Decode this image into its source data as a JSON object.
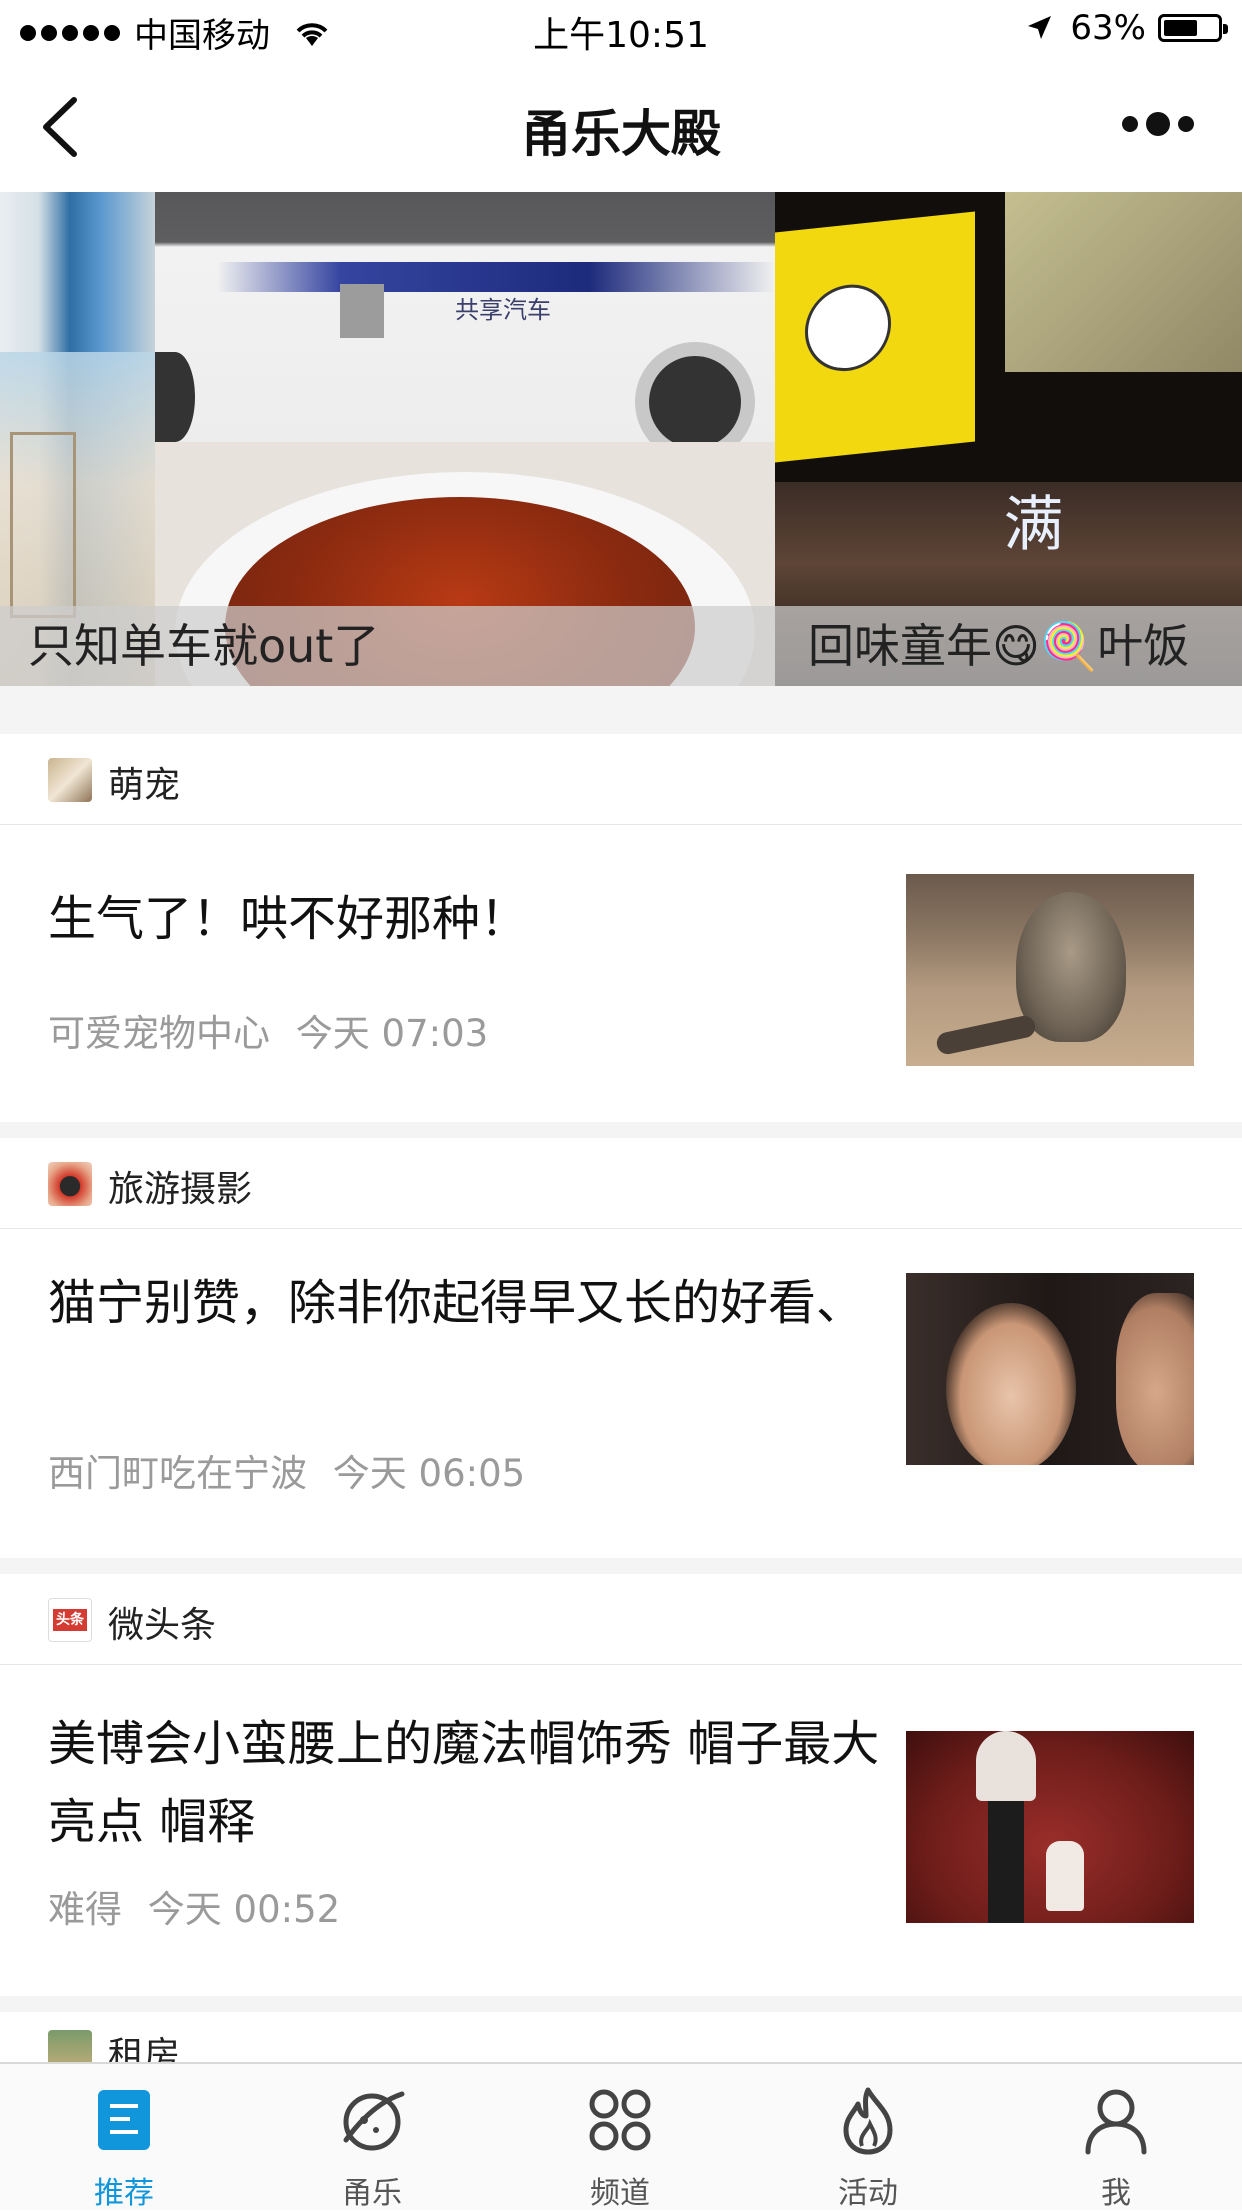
{
  "status_bar": {
    "carrier": "中国移动",
    "time": "上午10:51",
    "battery": "63%",
    "battery_level": 0.63
  },
  "nav": {
    "title": "甬乐大殿",
    "back_icon": "chevron-left-icon",
    "more_icon": "more-dots-icon"
  },
  "banner": {
    "slides": [
      {
        "caption": "只知单车就out了"
      },
      {
        "caption": "回味童年😋🍭叶饭"
      }
    ],
    "page_count": 4,
    "active_page": 4
  },
  "feed": {
    "sections": [
      {
        "name": "萌宠",
        "icon": "pet-avatar-icon",
        "article": {
          "title": "生气了！哄不好那种！",
          "source": "可爱宠物中心",
          "time": "今天 07:03"
        }
      },
      {
        "name": "旅游摄影",
        "icon": "camera-avatar-icon",
        "article": {
          "title": "猫宁别赞，除非你起得早又长的好看、",
          "source": "西门町吃在宁波",
          "time": "今天 06:05"
        }
      },
      {
        "name": "微头条",
        "icon": "toutiao-logo-icon",
        "icon_text": "头条",
        "article": {
          "title": "美博会小蛮腰上的魔法帽饰秀 帽子最大亮点 帽释",
          "source": "难得",
          "time": "今天 00:52"
        }
      },
      {
        "name": "租房",
        "icon": "house-avatar-icon"
      }
    ]
  },
  "tabbar": {
    "accent_color": "#1296db",
    "tabs": [
      {
        "label": "推荐",
        "icon": "list-doc-icon",
        "active": true
      },
      {
        "label": "甬乐",
        "icon": "planet-icon",
        "active": false
      },
      {
        "label": "频道",
        "icon": "grid-four-icon",
        "active": false
      },
      {
        "label": "活动",
        "icon": "flame-icon",
        "active": false
      },
      {
        "label": "我",
        "icon": "user-icon",
        "active": false
      }
    ]
  }
}
